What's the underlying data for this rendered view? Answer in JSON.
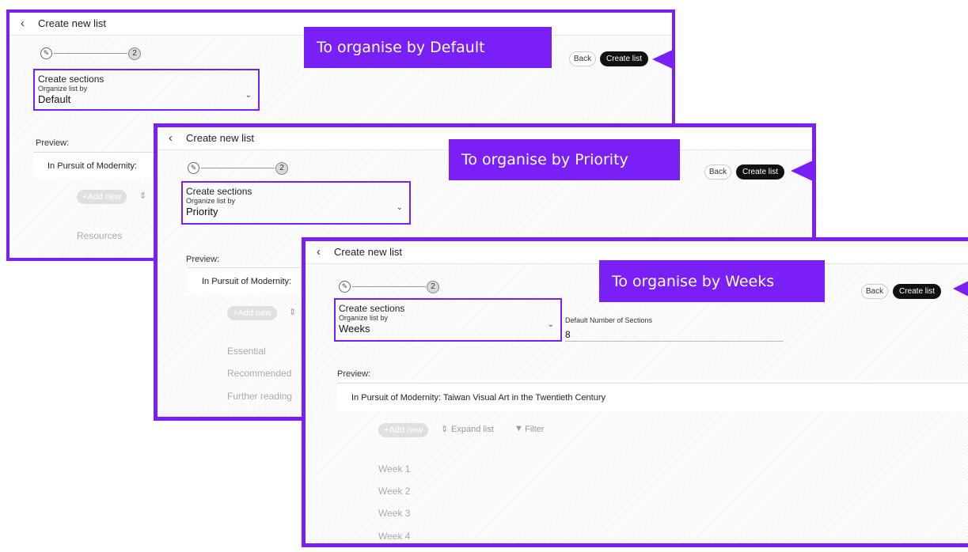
{
  "colors": {
    "accent": "#7a1ff5",
    "primary_button": "#111111"
  },
  "icons": {
    "back": "chevron-left-icon",
    "edit_step": "pencil-icon",
    "dropdown": "chevron-down-icon",
    "expand": "expand-icon",
    "filter": "filter-icon"
  },
  "common": {
    "header_title": "Create new list",
    "back_chevron": "‹",
    "step_pencil": "✎",
    "step_two": "2",
    "section_title": "Create sections",
    "section_subtitle": "Organize list by",
    "dropdown_chevron": "⌄",
    "back_button": "Back",
    "create_button": "Create list",
    "preview_label": "Preview:",
    "add_new": "+Add new",
    "expand_list": "Expand list",
    "filter": "Filter"
  },
  "panels": [
    {
      "callout": "To organise by Default",
      "organize_value": "Default",
      "list_title": "In Pursuit of Modernity:",
      "sections": [
        "Resources"
      ]
    },
    {
      "callout": "To organise by Priority",
      "organize_value": "Priority",
      "list_title": "In Pursuit of Modernity:",
      "sections": [
        "Essential",
        "Recommended",
        "Further reading"
      ]
    },
    {
      "callout": "To organise by Weeks",
      "organize_value": "Weeks",
      "default_sections_label": "Default Number of Sections",
      "default_sections_value": "8",
      "list_title": "In Pursuit of Modernity: Taiwan Visual Art in the Twentieth Century",
      "sections": [
        "Week 1",
        "Week 2",
        "Week 3",
        "Week 4"
      ]
    }
  ]
}
